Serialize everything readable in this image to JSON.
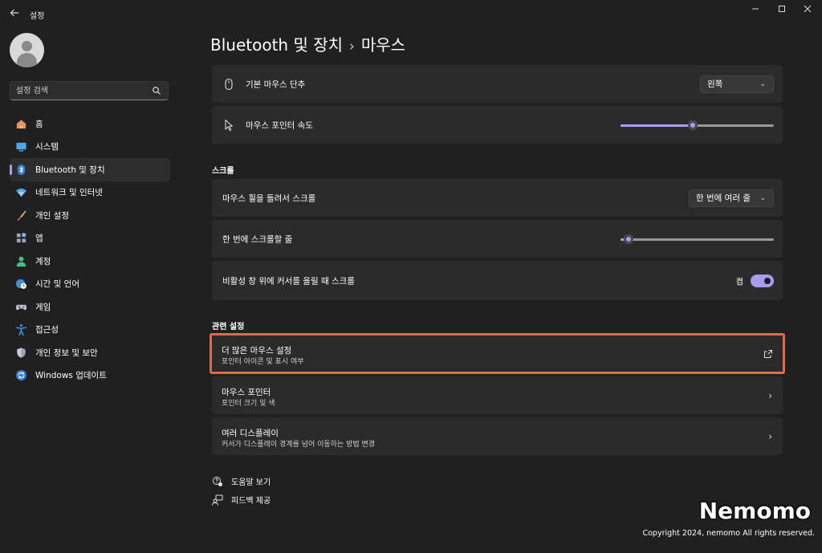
{
  "app": {
    "title": "설정"
  },
  "search": {
    "placeholder": "설정 검색"
  },
  "sidebar": {
    "items": [
      {
        "label": "홈",
        "icon": "home-icon"
      },
      {
        "label": "시스템",
        "icon": "system-icon"
      },
      {
        "label": "Bluetooth 및 장치",
        "icon": "bluetooth-icon",
        "active": true
      },
      {
        "label": "네트워크 및 인터넷",
        "icon": "wifi-icon"
      },
      {
        "label": "개인 설정",
        "icon": "brush-icon"
      },
      {
        "label": "앱",
        "icon": "apps-icon"
      },
      {
        "label": "계정",
        "icon": "account-icon"
      },
      {
        "label": "시간 및 언어",
        "icon": "globe-clock-icon"
      },
      {
        "label": "게임",
        "icon": "gamepad-icon"
      },
      {
        "label": "접근성",
        "icon": "accessibility-icon"
      },
      {
        "label": "개인 정보 및 보안",
        "icon": "shield-icon"
      },
      {
        "label": "Windows 업데이트",
        "icon": "update-icon"
      }
    ]
  },
  "header": {
    "crumb_parent": "Bluetooth 및 장치",
    "separator": "›",
    "crumb_current": "마우스"
  },
  "main": {
    "primary_button": {
      "label": "기본 마우스 단추",
      "value": "왼쪽"
    },
    "pointer_speed": {
      "label": "마우스 포인터 속도",
      "value_fraction": 0.47
    },
    "scroll_section": "스크롤",
    "wheel_scroll": {
      "label": "마우스 휠을 돌려서 스크롤",
      "value": "한 번에 여러 줄"
    },
    "lines_to_scroll": {
      "label": "한 번에 스크롤할 줄",
      "value_fraction": 0.05
    },
    "inactive_scroll": {
      "label": "비활성 창 위에 커서를 올릴 때 스크롤",
      "state": "켬",
      "on": true
    },
    "related_section": "관련 설정",
    "related": [
      {
        "title": "더 많은 마우스 설정",
        "subtitle": "포인터 아이콘 및 표시 여부",
        "icon": "external-link-icon"
      },
      {
        "title": "마우스 포인터",
        "subtitle": "포인터 크기 및 색",
        "icon": "chevron-right-icon"
      },
      {
        "title": "여러 디스플레이",
        "subtitle": "커서가 디스플레이 경계를 넘어 이동하는 방법 변경",
        "icon": "chevron-right-icon"
      }
    ],
    "help": "도움말 보기",
    "feedback": "피드백 제공"
  },
  "watermark": {
    "brand": "Nemomo",
    "copyright": "Copyright 2024, nemomo All rights reserved."
  },
  "colors": {
    "accent": "#a99cf0",
    "highlight_border": "#e06a4a",
    "background": "#202020",
    "card": "#2b2b2b"
  }
}
